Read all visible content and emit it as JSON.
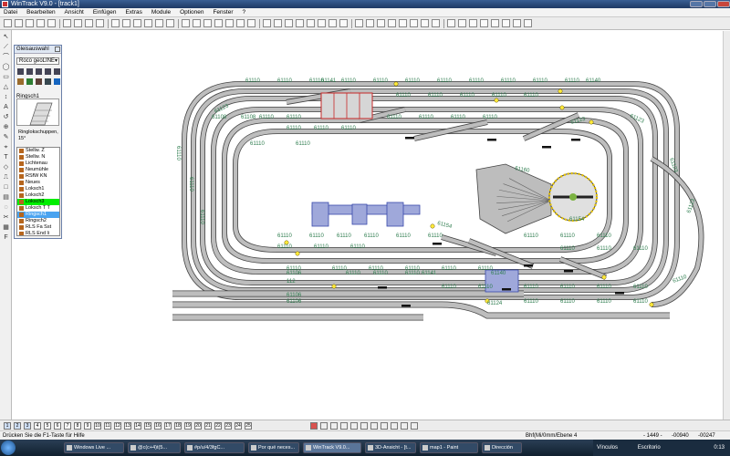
{
  "window": {
    "title": "WinTrack  V9.0 - [track1]"
  },
  "menu": [
    "Datei",
    "Bearbeiten",
    "Ansicht",
    "Einfügen",
    "Extras",
    "Module",
    "Optionen",
    "Fenster",
    "?"
  ],
  "panel": {
    "title": "Gleisauswahl",
    "system": "Roco geoLINE",
    "preview_name": "Ringsch1",
    "preview_desc": "Ringlokschuppen, 15°",
    "list": [
      "Stellw. Z",
      "Stellw. N",
      "Lichtenau",
      "Neumühle",
      "RSfW KN",
      "Neues",
      "Loksch1",
      "Loksch2",
      "Loksch3",
      "Loksch T T",
      "Ringsch1",
      "Ringsch2",
      "RLS Fa Sst",
      "RLS End li",
      "RLS End re"
    ],
    "highlight_green": 8,
    "highlight_blue": 10
  },
  "track_labels": {
    "code": "61110",
    "alt_codes": [
      "61141",
      "61140",
      "61123",
      "61106",
      "61108",
      "112",
      "61160",
      "61154",
      "61124"
    ]
  },
  "page_tabs": [
    "1",
    "2",
    "3",
    "4",
    "5",
    "6",
    "7",
    "8",
    "9",
    "10",
    "11",
    "12",
    "13",
    "14",
    "15",
    "16",
    "17",
    "18",
    "19",
    "20",
    "21",
    "22",
    "23",
    "24",
    "25"
  ],
  "status": {
    "help": "Drücken Sie die  F1-Taste für Hilfe",
    "mode": "Bhf(Mi/0mm/Ebene 4",
    "coord1": "- 1449 -",
    "coord2": "-00940",
    "coord3": "-00247"
  },
  "taskbar": {
    "items": [
      "Windows Live ...",
      "@c(c+4)t(5...",
      "#p/u/4/3fgC...",
      "Por qué neces...",
      "WinTrack V9.0...",
      "3D-Ansicht - [t...",
      "map1 - Paint",
      "Dirección"
    ],
    "active_index": 4,
    "tray_links": "Vínculos",
    "tray_desktop": "Escritorio",
    "clock": "0:13"
  }
}
